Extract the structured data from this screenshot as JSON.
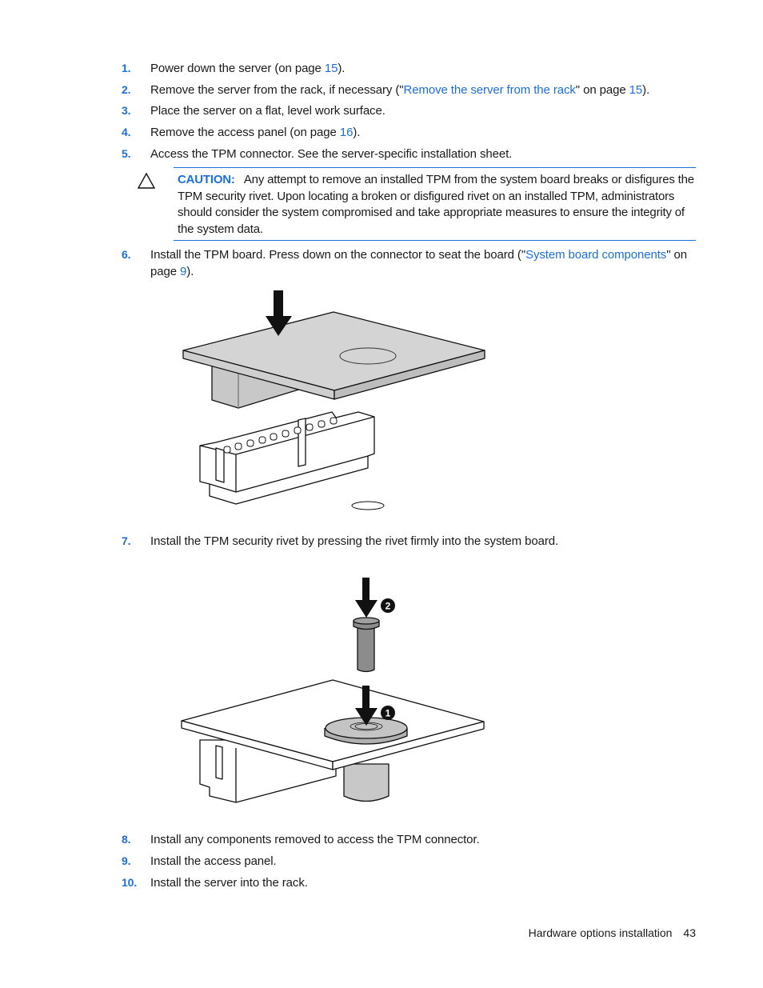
{
  "steps": [
    {
      "num": "1.",
      "parts": [
        "Power down the server (on page ",
        "15",
        ")."
      ]
    },
    {
      "num": "2.",
      "parts": [
        "Remove the server from the rack, if necessary (\"",
        "Remove the server from the rack",
        "\" on page ",
        "15",
        ")."
      ]
    },
    {
      "num": "3.",
      "text": "Place the server on a flat, level work surface."
    },
    {
      "num": "4.",
      "parts": [
        "Remove the access panel (on page ",
        "16",
        ")."
      ]
    },
    {
      "num": "5.",
      "text": "Access the TPM connector. See the server-specific installation sheet."
    },
    {
      "num": "6.",
      "parts": [
        "Install the TPM board. Press down on the connector to seat the board (\"",
        "System board components",
        "\" on page ",
        "9",
        ")."
      ]
    },
    {
      "num": "7.",
      "text": "Install the TPM security rivet by pressing the rivet firmly into the system board."
    },
    {
      "num": "8.",
      "text": "Install any components removed to access the TPM connector."
    },
    {
      "num": "9.",
      "text": "Install the access panel."
    },
    {
      "num": "10.",
      "text": "Install the server into the rack."
    }
  ],
  "caution": {
    "label": "CAUTION:",
    "text": "Any attempt to remove an installed TPM from the system board breaks or disfigures the TPM security rivet. Upon locating a broken or disfigured rivet on an installed TPM, administrators should consider the system compromised and take appropriate measures to ensure the integrity of the system data.",
    "icon": "warning-triangle-icon"
  },
  "figures": {
    "tpm_board": {
      "description": "TPM board being pressed onto connector"
    },
    "rivet": {
      "description": "TPM security rivet installation",
      "callouts": [
        "1",
        "2"
      ]
    }
  },
  "footer": {
    "section": "Hardware options installation",
    "page": "43"
  },
  "colors": {
    "accent": "#1c6fd6",
    "board_fill": "#d4d4d4",
    "rivet_fill": "#8c8c8c"
  }
}
